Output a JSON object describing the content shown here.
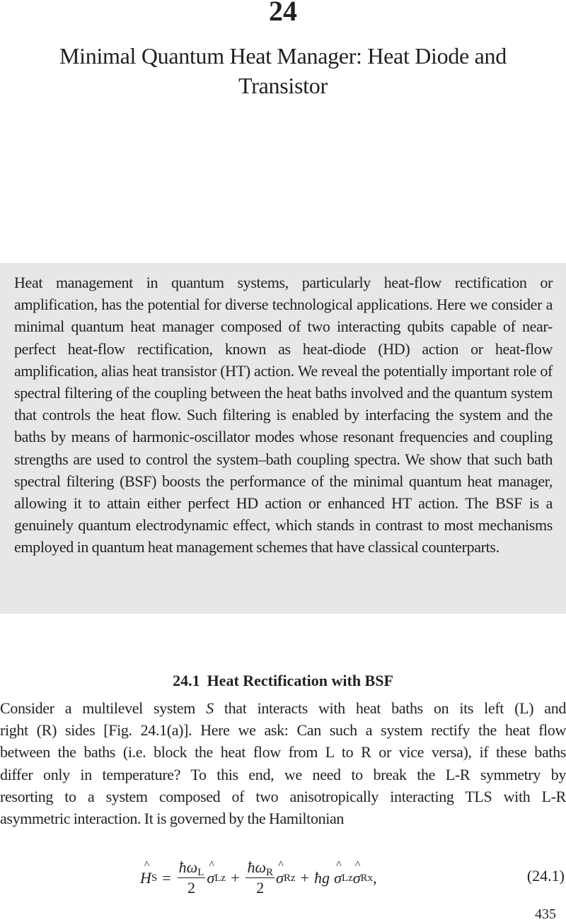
{
  "chapter": {
    "number": "24",
    "title": "Minimal Quantum Heat Manager: Heat Diode and Transistor"
  },
  "abstract": {
    "text": "Heat management in quantum systems, particularly heat-flow rectification or amplification, has the potential for diverse technological applications. Here we consider a minimal quantum heat manager composed of two interacting qubits capable of near-perfect heat-flow rectification, known as heat-diode (HD) action or heat-flow amplification, alias heat transistor (HT) action. We reveal the potentially important role of spectral filtering of the coupling between the heat baths involved and the quantum system that controls the heat flow. Such filtering is enabled by interfacing the system and the baths by means of harmonic-oscillator modes whose resonant frequencies and coupling strengths are used to control the system–bath coupling spectra. We show that such bath spectral filtering (BSF) boosts the performance of the minimal quantum heat manager, allowing it to attain either perfect HD action or enhanced HT action. The BSF is a genuinely quantum electrodynamic effect, which stands in contrast to most mechanisms employed in quantum heat management schemes that have classical counterparts."
  },
  "section": {
    "number": "24.1",
    "title": "Heat Rectification with BSF"
  },
  "body": {
    "lines": [
      [
        "Consider a multilevel system ",
        "S",
        " that interacts with heat baths on its left (L) and"
      ],
      [
        "right (R) sides [Fig. 24.1(a)]. Here we ask: Can such a system rectify the heat flow",
        "",
        ""
      ],
      [
        "between the baths (i.e. block the heat flow from L to R or vice versa), if these baths",
        "",
        ""
      ],
      [
        "differ only in temperature? To this end, we need to break the L-R symmetry by",
        "",
        ""
      ],
      [
        "resorting to a system composed of two anisotropically interacting TLS with L-R",
        "",
        ""
      ],
      [
        "asymmetric interaction. It is governed by the Hamiltonian",
        "",
        ""
      ]
    ]
  },
  "equation": {
    "lhs_symbol": "H",
    "lhs_sub": "S",
    "equals": "=",
    "term1_num": "ħω",
    "term1_num_sub": "L",
    "term1_den": "2",
    "term1_sigma": "σ",
    "term1_sigma_sub": "Lz",
    "plus1": "+",
    "term2_num": "ħω",
    "term2_num_sub": "R",
    "term2_den": "2",
    "term2_sigma": "σ",
    "term2_sigma_sub": "Rz",
    "plus2": "+",
    "term3_coef": "ħg",
    "term3_sigma_a": "σ",
    "term3_sigma_a_sub": "Lz",
    "term3_sigma_b": "σ",
    "term3_sigma_b_sub": "Rx",
    "trailing": ",",
    "label": "(24.1)"
  },
  "page_number": "435"
}
